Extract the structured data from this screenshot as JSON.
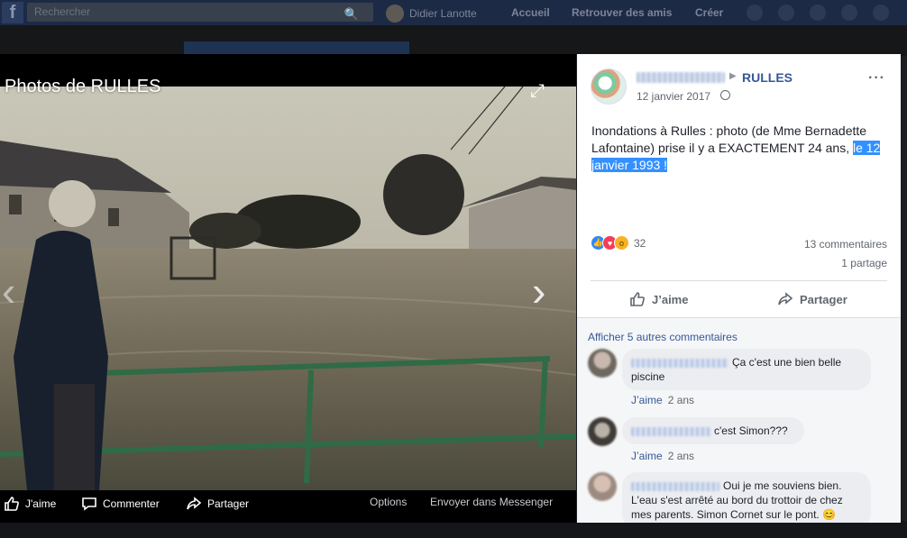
{
  "topbar": {
    "logo": "f",
    "search_placeholder": "Rechercher",
    "user_name": "Didier Lanotte",
    "nav": [
      "Accueil",
      "Retrouver des amis",
      "Créer"
    ]
  },
  "viewer": {
    "title": "Photos de RULLES",
    "actions": {
      "like": "J'aime",
      "comment": "Commenter",
      "share": "Partager",
      "options": "Options",
      "messenger": "Envoyer dans Messenger"
    }
  },
  "post": {
    "page_name": "RULLES",
    "date": "12 janvier 2017",
    "text_before": "Inondations à Rulles : photo (de Mme Bernadette Lafontaine) prise il y a EXACTEMENT 24 ans, ",
    "text_highlight": "le 12 janvier 1993 !",
    "reactions_count": "32",
    "comments_count": "13 commentaires",
    "shares_count": "1 partage",
    "like_label": "J’aime",
    "share_label": "Partager"
  },
  "comments": {
    "more_link": "Afficher 5 autres commentaires",
    "items": [
      {
        "text": "Ça c'est une bien belle piscine",
        "like": "J’aime",
        "age": "2 ans"
      },
      {
        "text": "c'est Simon???",
        "like": "J’aime",
        "age": "2 ans"
      },
      {
        "text": "Oui je me souviens bien. L'eau s'est arrêté au bord du trottoir de chez mes parents. Simon Cornet sur le pont.",
        "emoji": "😊"
      }
    ]
  },
  "colors": {
    "link": "#365899",
    "highlight": "#3390ff",
    "viewer_bg": "#000000"
  }
}
